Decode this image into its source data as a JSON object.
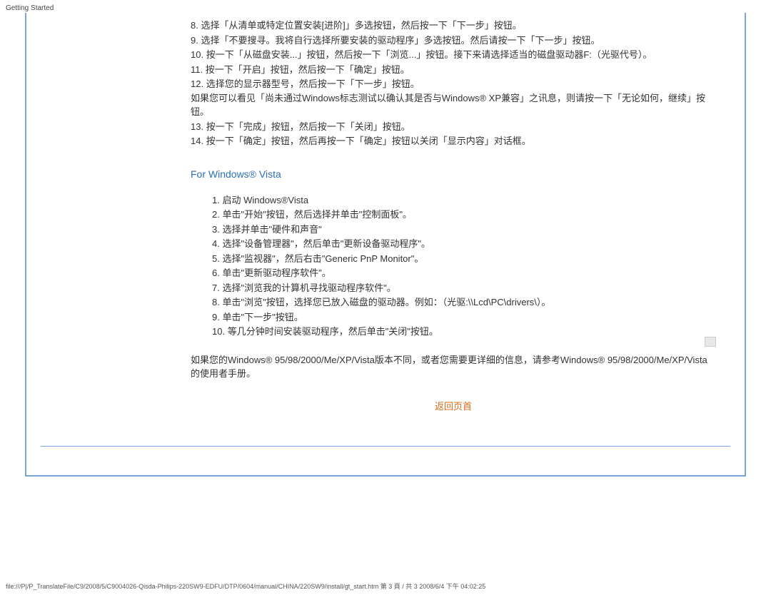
{
  "header": {
    "label": "Getting Started"
  },
  "xp_list": [
    {
      "num": "8.",
      "text": "选择「从清单或特定位置安装[进阶]」多选按钮，然后按一下「下一步」按钮。"
    },
    {
      "num": "9.",
      "text": "选择「不要搜寻。我将自行选择所要安装的驱动程序」多选按钮。然后请按一下「下一步」按钮。"
    },
    {
      "num": "10.",
      "text": "按一下「从磁盘安装...」按钮，然后按一下「浏览...」按钮。接下来请选择适当的磁盘驱动器F:（光驱代号）。"
    },
    {
      "num": "11.",
      "text": "按一下「开启」按钮，然后按一下「确定」按钮。"
    },
    {
      "num": "12.",
      "text": "选择您的显示器型号，然后按一下「下一步」按钮。\n如果您可以看见「尚未通过Windows标志测试以确认其是否与Windows® XP兼容」之讯息，则请按一下「无论如何，继续」按钮。"
    },
    {
      "num": "13.",
      "text": "按一下「完成」按钮，然后按一下「关闭」按钮。"
    },
    {
      "num": "14.",
      "text": "按一下「确定」按钮，然后再按一下「确定」按钮以关闭「显示内容」对话框。"
    }
  ],
  "vista_heading": "For Windows® Vista",
  "vista_list": [
    {
      "num": "1.",
      "text": "启动 Windows®Vista"
    },
    {
      "num": "2.",
      "text": "单击\"开始\"按钮，然后选择并单击\"控制面板\"。"
    },
    {
      "num": "3.",
      "text": "选择并单击\"硬件和声音\""
    },
    {
      "num": "4.",
      "text": "选择\"设备管理器\"，然后单击\"更新设备驱动程序\"。"
    },
    {
      "num": "5.",
      "text": "选择\"监视器\"，然后右击\"Generic PnP Monitor\"。"
    },
    {
      "num": "6.",
      "text": "单击\"更新驱动程序软件\"。"
    },
    {
      "num": "7.",
      "text": "选择\"浏览我的计算机寻找驱动程序软件\"。"
    },
    {
      "num": "8.",
      "text": "单击\"浏览\"按钮，选择您已放入磁盘的驱动器。例如：（光驱:\\\\Lcd\\PC\\drivers\\）。"
    },
    {
      "num": "9.",
      "text": "单击\"下一步\"按钮。"
    },
    {
      "num": "10.",
      "text": "等几分钟时间安装驱动程序，然后单击\"关闭\"按钮。"
    }
  ],
  "note": "如果您的Windows® 95/98/2000/Me/XP/Vista版本不同，或者您需要更详细的信息，请参考Windows® 95/98/2000/Me/XP/Vista的使用者手册。",
  "back_link": "返回页首",
  "footer_url": "file:///P|/P_TranslateFile/C9/2008/5/C9004026-Qisda-Philips-220SW9-EDFU/DTP/0604/manual/CHINA/220SW9/install/gt_start.htm 第 3 頁 / 共 3 2008/6/4 下午 04:02:25"
}
